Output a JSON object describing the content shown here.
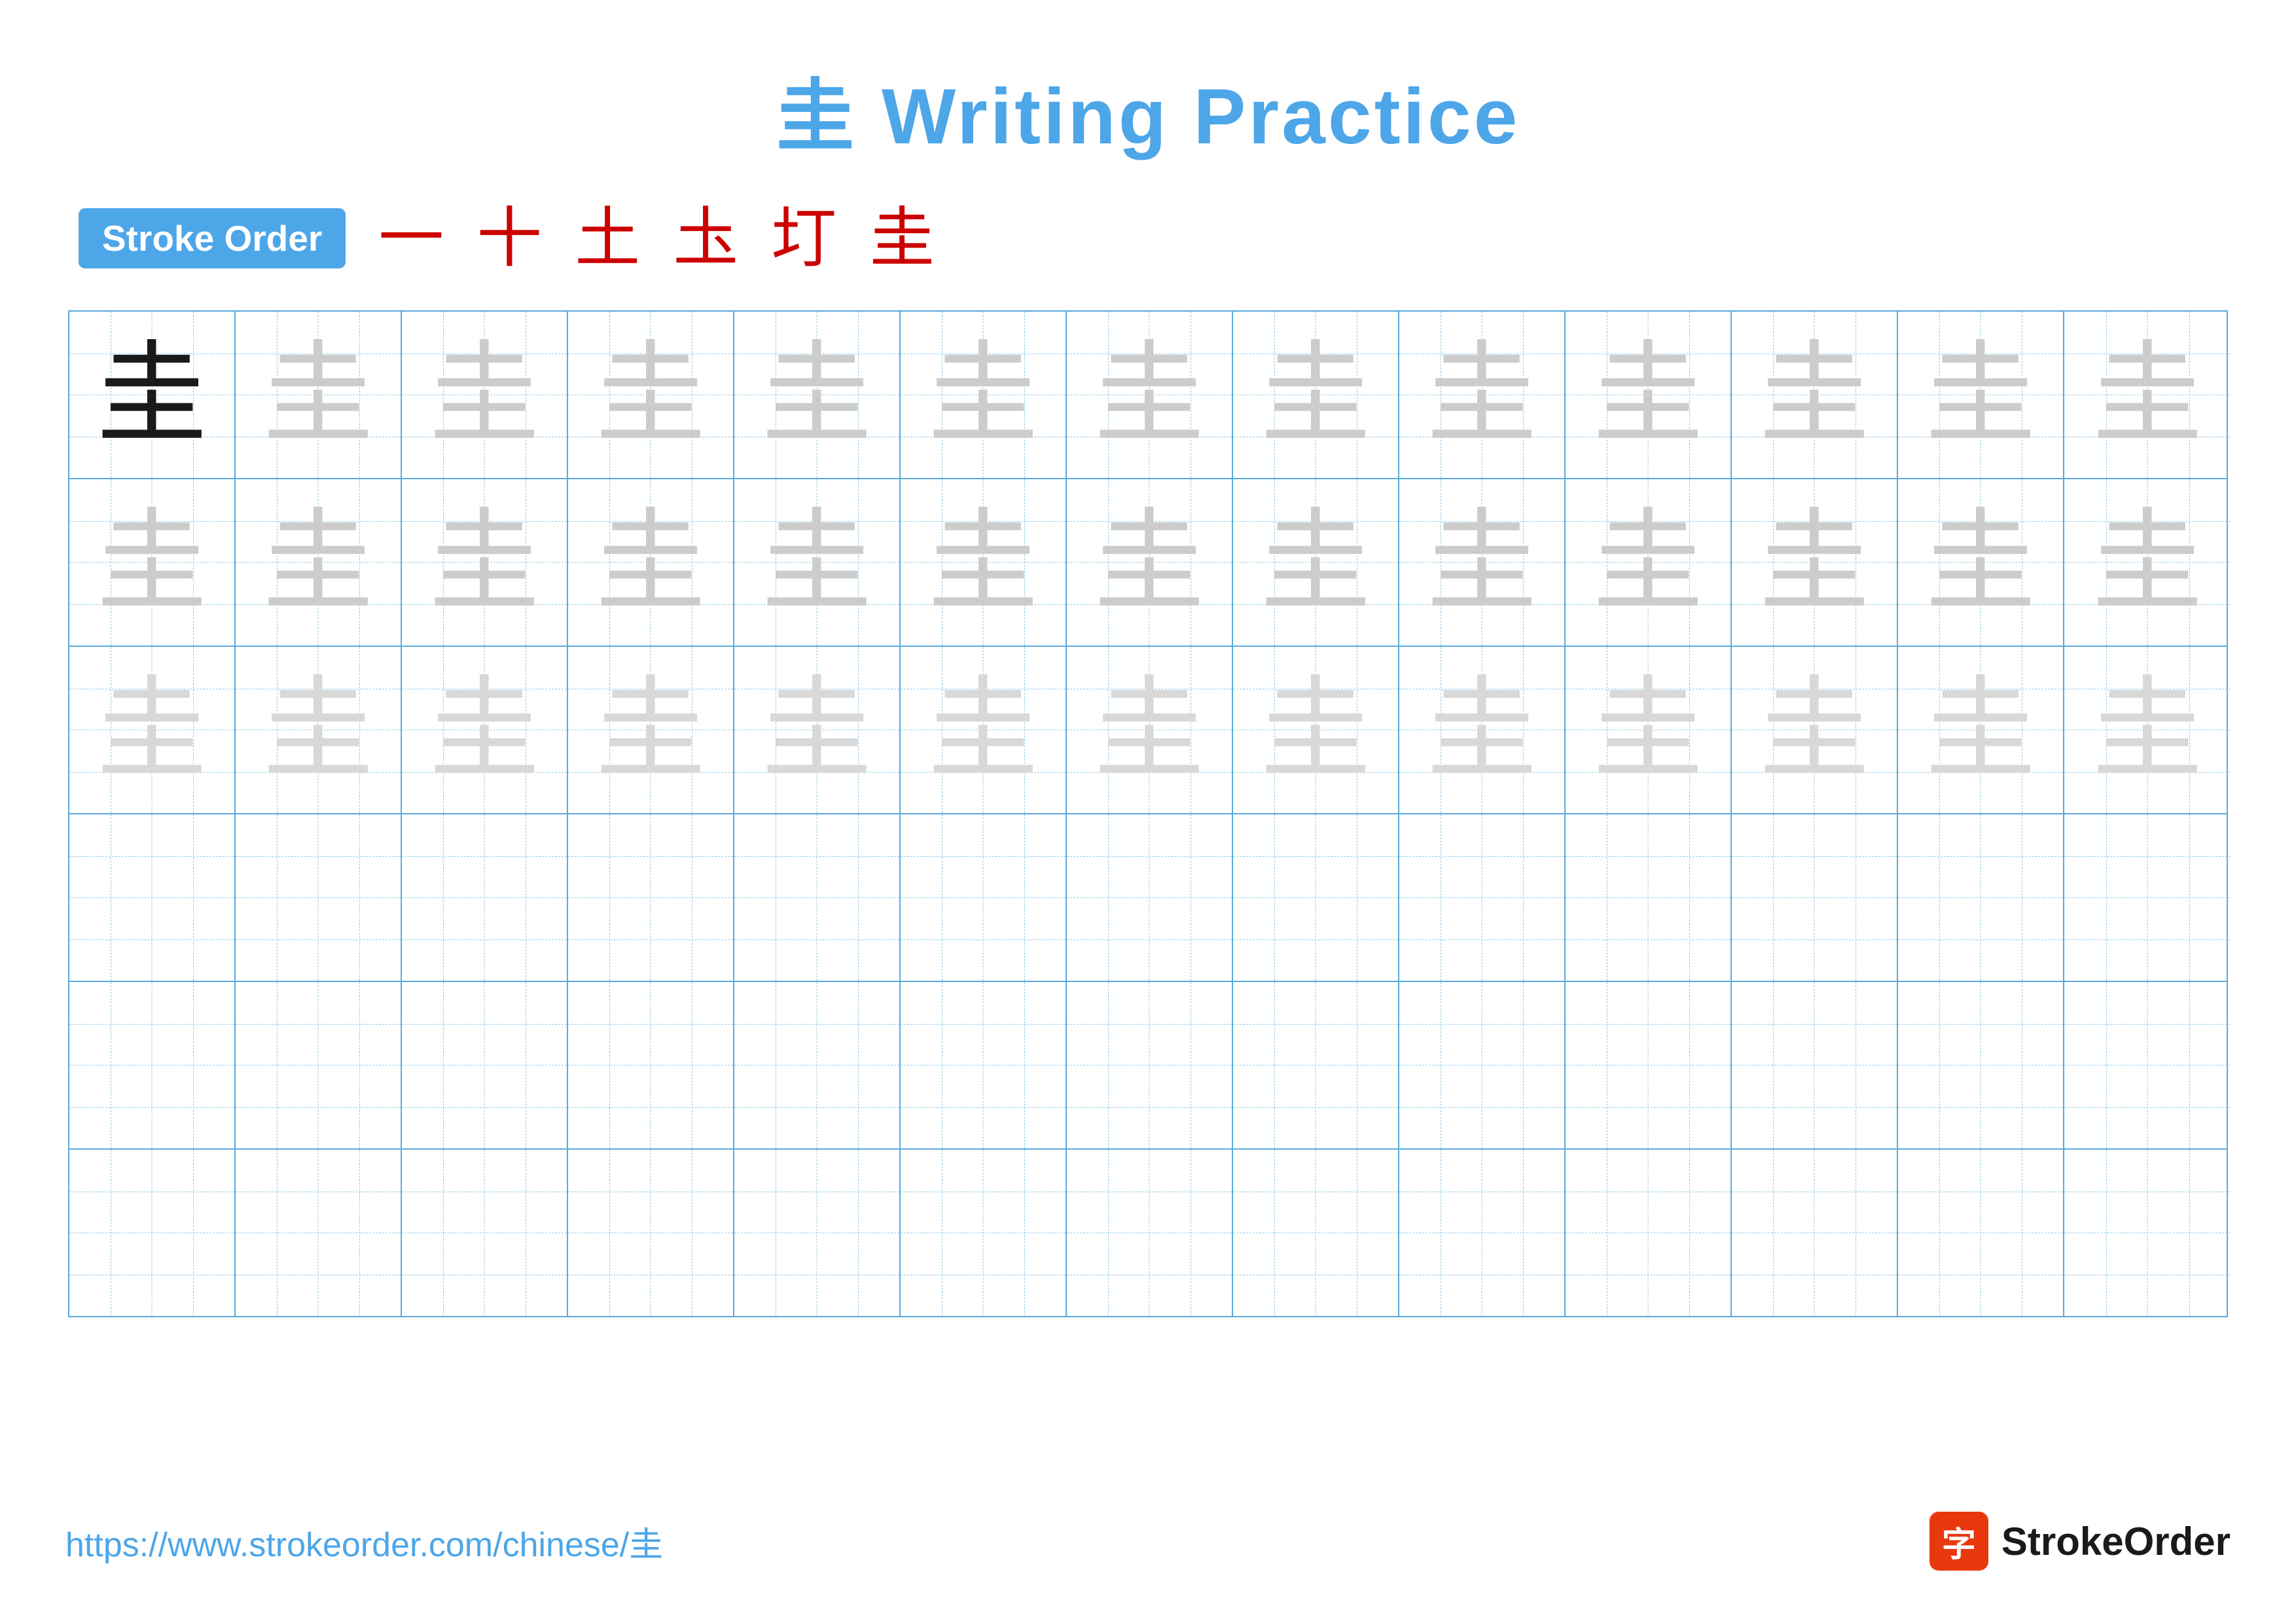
{
  "title": {
    "character": "圭",
    "text": " Writing Practice"
  },
  "stroke_order": {
    "badge_label": "Stroke Order",
    "steps": [
      "一",
      "十",
      "土",
      "圡",
      "圢",
      "圭"
    ]
  },
  "grid": {
    "rows": 6,
    "cols": 13,
    "row_types": [
      "solid_then_light",
      "all_light",
      "all_lighter",
      "empty",
      "empty",
      "empty"
    ]
  },
  "footer": {
    "url": "https://www.strokeorder.com/chinese/圭",
    "logo_icon": "字",
    "logo_text": "StrokeOrder"
  },
  "colors": {
    "title_blue": "#4da6e8",
    "badge_blue": "#4da6e8",
    "stroke_red": "#cc0000",
    "grid_blue": "#5aaadc",
    "guide_blue": "#90c8ea",
    "char_solid": "#1a1a1a",
    "char_light": "#cccccc",
    "logo_red": "#e8380d"
  }
}
